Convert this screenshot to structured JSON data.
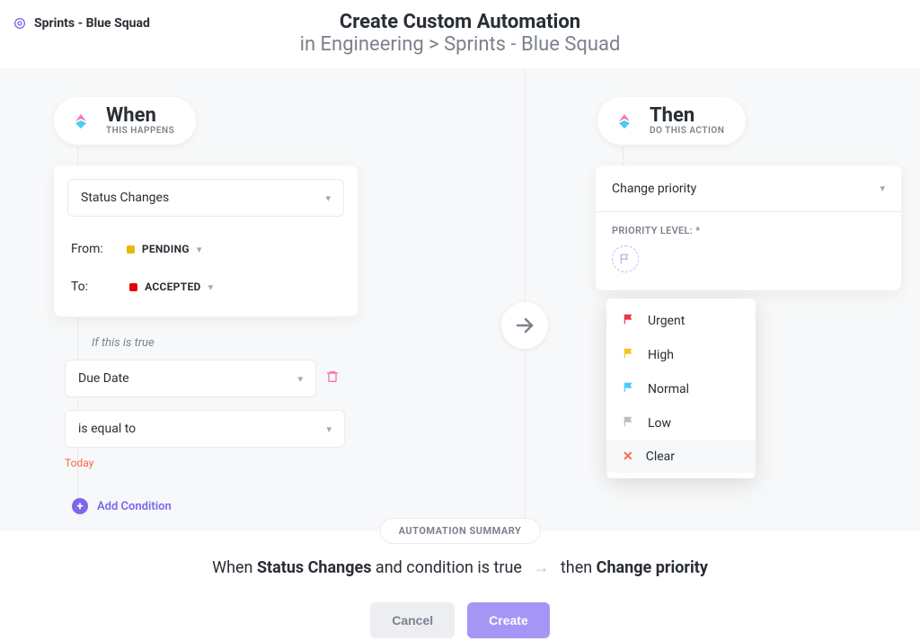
{
  "location": "Sprints - Blue Squad",
  "header": {
    "title": "Create Custom Automation",
    "sub": "in Engineering > Sprints - Blue Squad"
  },
  "when": {
    "title": "When",
    "sub": "THIS HAPPENS",
    "trigger": "Status Changes",
    "from_label": "From:",
    "from_status": "PENDING",
    "to_label": "To:",
    "to_status": "ACCEPTED",
    "if_text": "If this is true",
    "cond_field": "Due Date",
    "cond_op": "is equal to",
    "cond_val": "Today",
    "add_cond": "Add Condition"
  },
  "then": {
    "title": "Then",
    "sub": "DO THIS ACTION",
    "action": "Change priority",
    "prio_label": "PRIORITY LEVEL: *",
    "menu": {
      "urgent": "Urgent",
      "high": "High",
      "normal": "Normal",
      "low": "Low",
      "clear": "Clear"
    }
  },
  "summary": {
    "chip": "AUTOMATION SUMMARY",
    "pre": "When ",
    "trigger": "Status Changes",
    "mid": " and condition is true",
    "then_pre": "then ",
    "action": "Change priority"
  },
  "buttons": {
    "cancel": "Cancel",
    "create": "Create"
  }
}
